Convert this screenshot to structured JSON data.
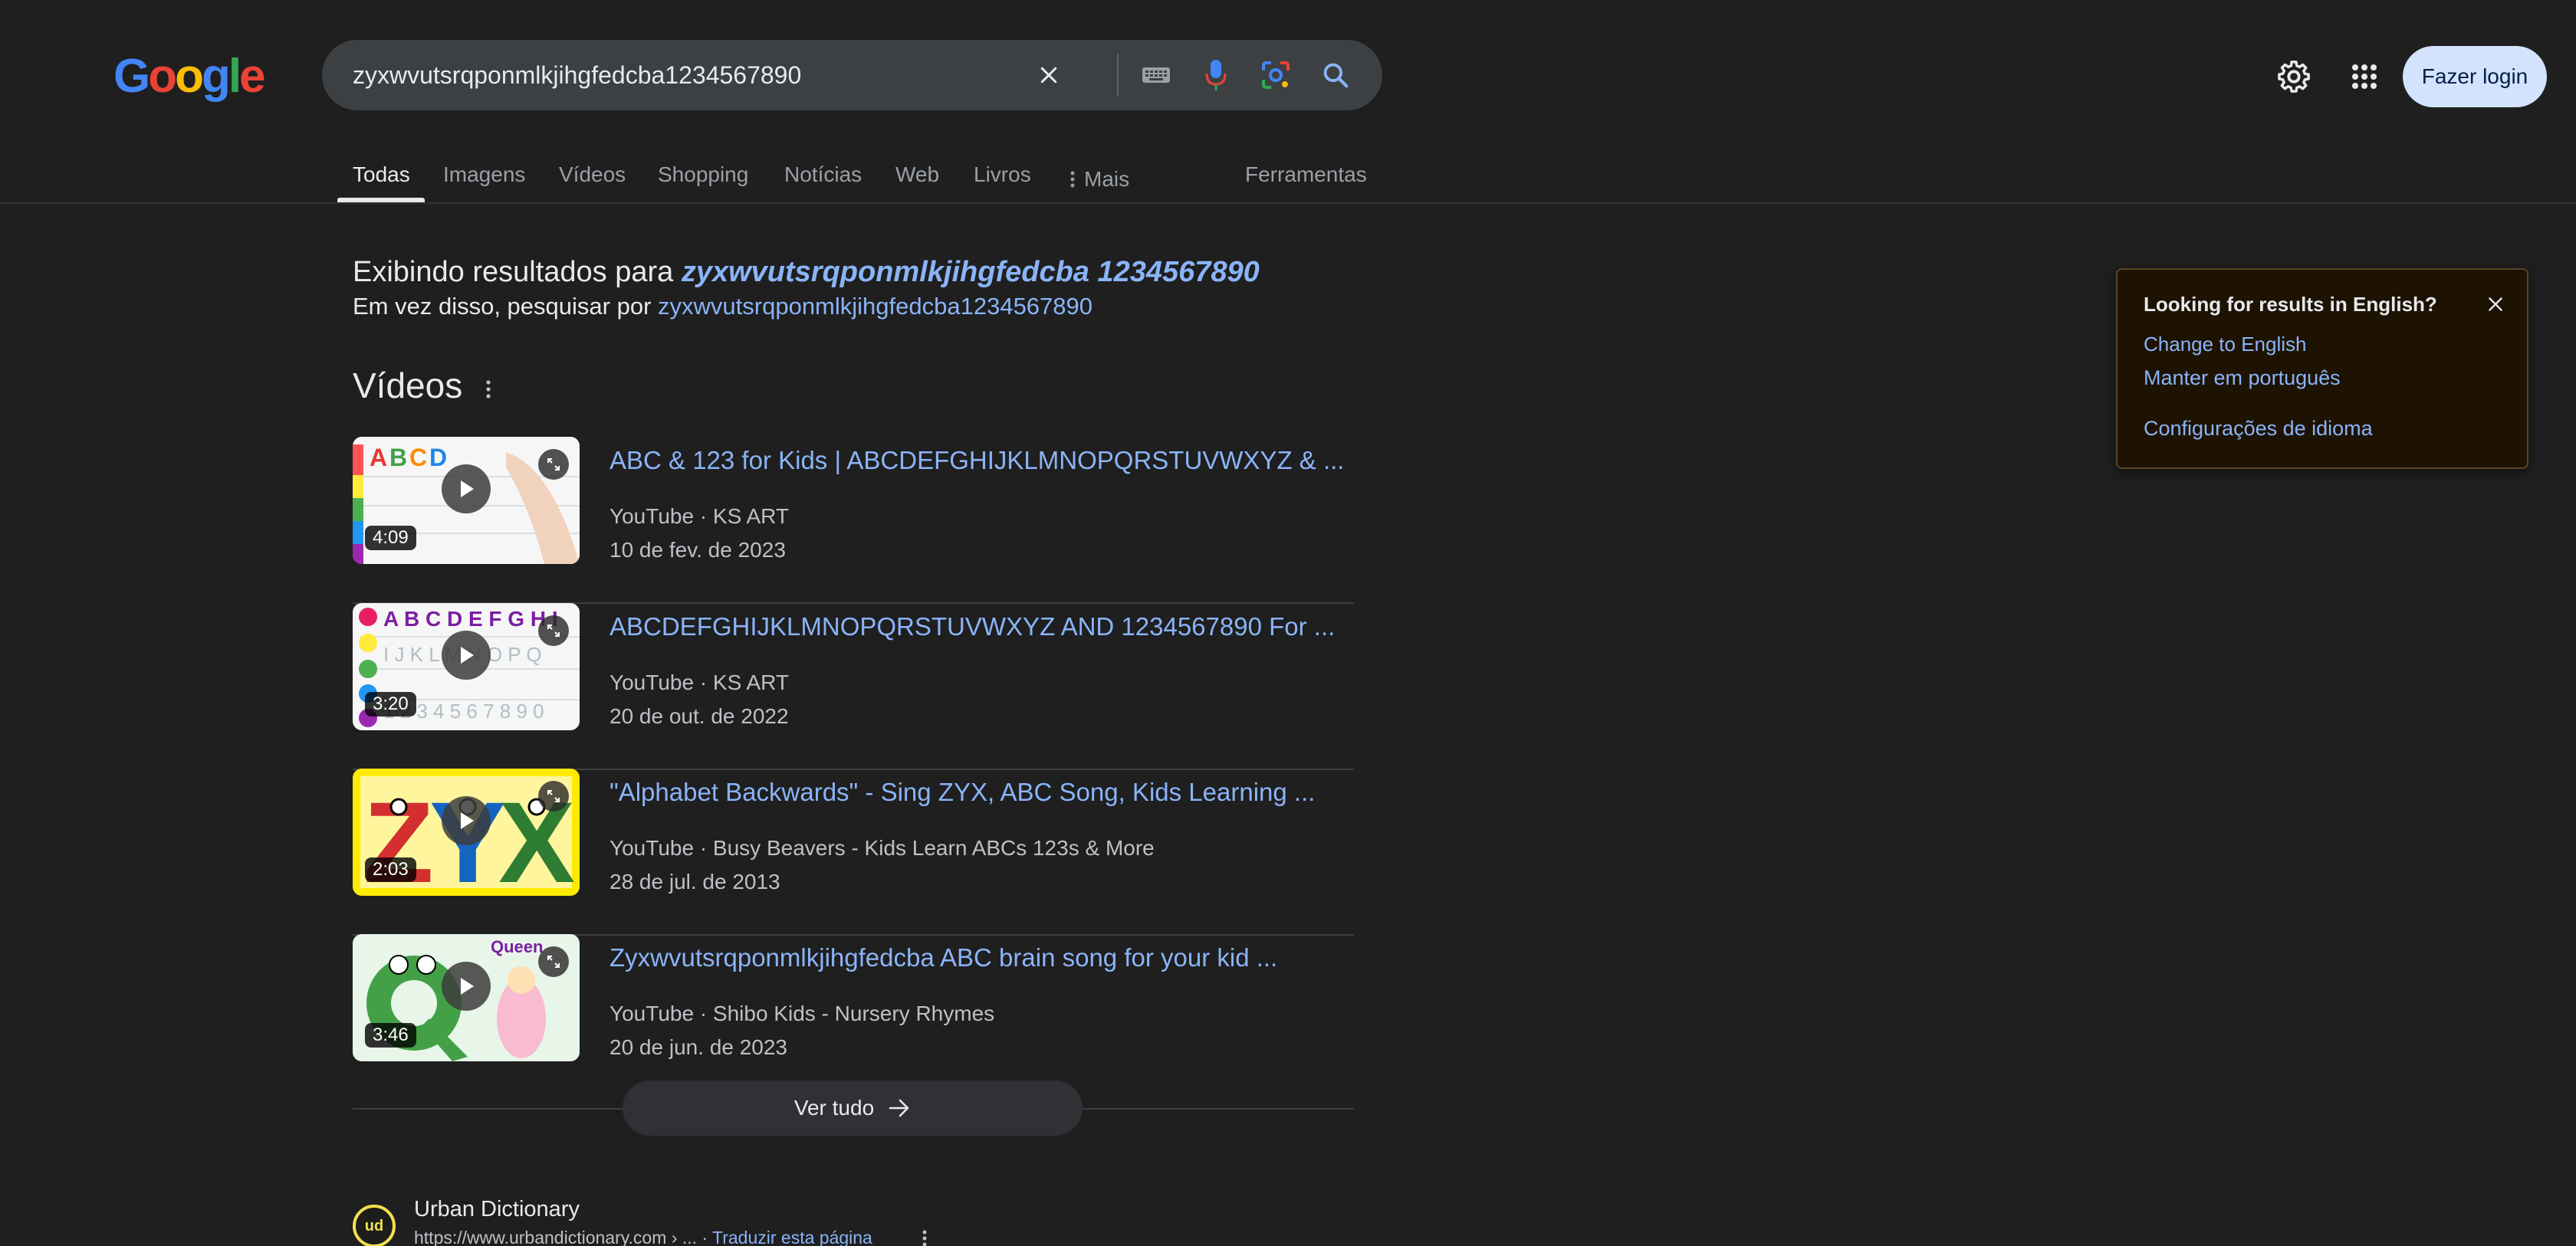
{
  "colors": {
    "background": "#1f1f1f",
    "link": "#8ab4f8",
    "search_bg": "#3c4043",
    "login_bg": "#d3e3fd"
  },
  "header": {
    "search_query": "zyxwvutsrqponmlkjihgfedcba1234567890",
    "icons": [
      "close-icon",
      "keyboard-icon",
      "microphone-icon",
      "lens-icon",
      "search-icon"
    ],
    "settings_icon": "gear-icon",
    "apps_icon": "apps-grid-icon",
    "login_label": "Fazer login"
  },
  "tabs": [
    {
      "label": "Todas",
      "active": true
    },
    {
      "label": "Imagens"
    },
    {
      "label": "Vídeos"
    },
    {
      "label": "Shopping"
    },
    {
      "label": "Notícias"
    },
    {
      "label": "Web"
    },
    {
      "label": "Livros"
    },
    {
      "label": "Mais"
    },
    {
      "label": "Ferramentas"
    }
  ],
  "correction": {
    "showing_prefix": "Exibindo resultados para",
    "corrected_query": "zyxwvutsrqponmlkjihgfedcba 1234567890",
    "instead_prefix": "Em vez disso, pesquisar por",
    "original_query": "zyxwvutsrqponmlkjihgfedcba1234567890"
  },
  "videos": {
    "heading": "Vídeos",
    "items": [
      {
        "title": "ABC & 123 for Kids | ABCDEFGHIJKLMNOPQRSTUVWXYZ & ...",
        "source": "YouTube · KS ART",
        "date": "10 de fev. de 2023",
        "duration": "4:09"
      },
      {
        "title": "ABCDEFGHIJKLMNOPQRSTUVWXYZ AND 1234567890 For ...",
        "source": "YouTube · KS ART",
        "date": "20 de out. de 2022",
        "duration": "3:20"
      },
      {
        "title": "\"Alphabet Backwards\" - Sing ZYX, ABC Song, Kids Learning ...",
        "source": "YouTube · Busy Beavers - Kids Learn ABCs 123s & More",
        "date": "28 de jul. de 2013",
        "duration": "2:03"
      },
      {
        "title": "Zyxwvutsrqponmlkjihgfedcba ABC brain song for your kid ...",
        "source": "YouTube · Shibo Kids - Nursery Rhymes",
        "date": "20 de jun. de 2023",
        "duration": "3:46"
      }
    ],
    "see_all_label": "Ver tudo"
  },
  "result": {
    "site_name": "Urban Dictionary",
    "favicon_text": "ud",
    "url": "https://www.urbandictionary.com › ...",
    "translate_label": "Traduzir esta página"
  },
  "language_popup": {
    "title": "Looking for results in English?",
    "change_label": "Change to English",
    "keep_label": "Manter em português",
    "settings_label": "Configurações de idioma"
  }
}
